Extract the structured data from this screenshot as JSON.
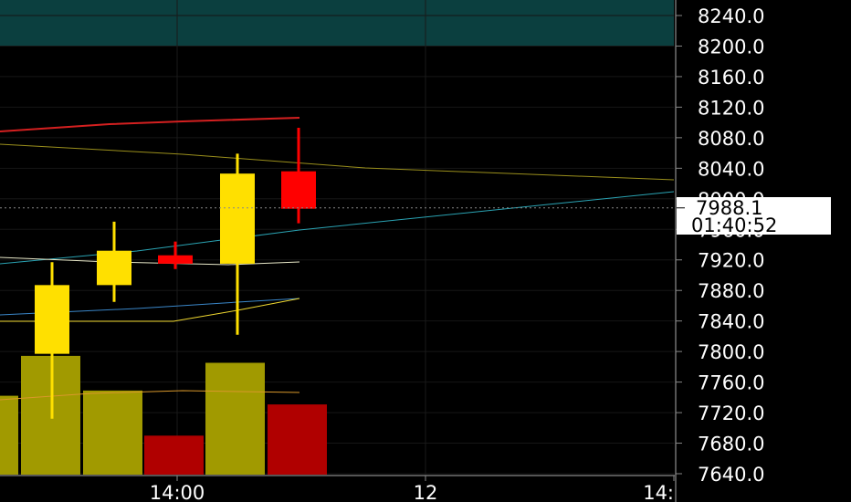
{
  "chart_data": {
    "type": "candlestick",
    "y_axis": {
      "ticks": [
        8240,
        8200,
        8160,
        8120,
        8080,
        8040,
        8000,
        7960,
        7920,
        7880,
        7840,
        7800,
        7760,
        7720,
        7680,
        7640
      ],
      "tick_labels": [
        "8240.0",
        "8200.0",
        "8160.0",
        "8120.0",
        "8080.0",
        "8040.0",
        "8000.0",
        "7960.0",
        "7920.0",
        "7880.0",
        "7840.0",
        "7800.0",
        "7760.0",
        "7720.0",
        "7680.0",
        "7640.0"
      ],
      "range": [
        7637,
        8256
      ]
    },
    "x_axis": {
      "tick_labels": [
        "14:00",
        "12",
        "14:"
      ]
    },
    "last_price_label": "7988.1",
    "countdown_label": "01:40:52",
    "candles": [
      {
        "open": 7797,
        "high": 7917,
        "low": 7712,
        "close": 7887,
        "color": "yellow"
      },
      {
        "open": 7887,
        "high": 7970,
        "low": 7865,
        "close": 7932,
        "color": "yellow"
      },
      {
        "open": 7926,
        "high": 7944,
        "low": 7908,
        "close": 7915,
        "color": "red"
      },
      {
        "open": 7915,
        "high": 8059,
        "low": 7822,
        "close": 8033,
        "color": "yellow"
      },
      {
        "open": 8036,
        "high": 8093,
        "low": 7968,
        "close": 7987,
        "color": "red"
      }
    ],
    "volume_bars": [
      {
        "value": 0.46,
        "color": "olive"
      },
      {
        "value": 0.69,
        "color": "olive"
      },
      {
        "value": 0.49,
        "color": "olive"
      },
      {
        "value": 0.23,
        "color": "red"
      },
      {
        "value": 0.65,
        "color": "olive"
      },
      {
        "value": 0.41,
        "color": "red"
      }
    ],
    "grid": true,
    "shaded_zone": {
      "from": 8200,
      "to": 8260
    },
    "colors": {
      "background": "#000000",
      "candle_up": "#ffe000",
      "candle_down": "#ff0000",
      "volume_up": "#a19a00",
      "volume_down": "#b00000",
      "zone": "#0b3f3f",
      "line_red": "#d42020",
      "line_olive": "#9a8f1c",
      "line_teal": "#2aa3b3",
      "line_blue": "#3a86c8",
      "line_yellow": "#f0d830",
      "line_white": "#e8e8c8",
      "line_orange": "#d9982b"
    }
  }
}
